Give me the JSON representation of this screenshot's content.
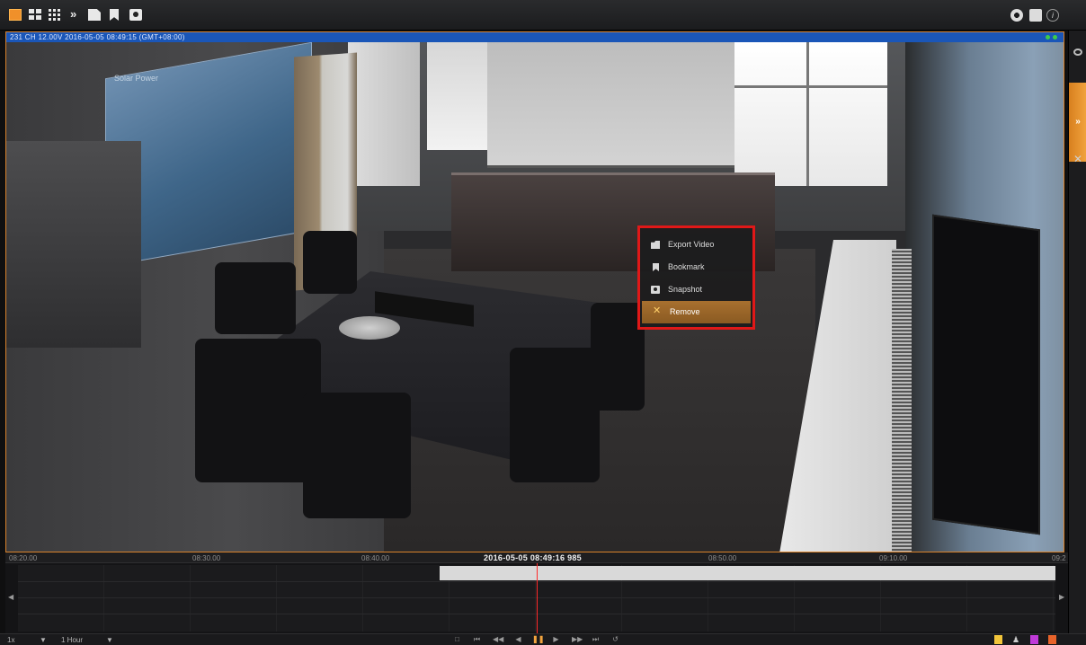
{
  "toolbar": {
    "more_label": "»",
    "info_label": "i",
    "icons": [
      "layout-single-icon",
      "layout-4-icon",
      "layout-9-icon",
      "more-icon",
      "save-icon",
      "bookmark-icon",
      "snapshot-icon",
      "settings-icon",
      "document-icon",
      "info-icon"
    ],
    "accent_color": "#f0902a"
  },
  "side_panel": {
    "expand_label": "»",
    "tools_label": "✕"
  },
  "video": {
    "header_text": "231 CH 12.00V 2016-05-05 08:49:15 (GMT+08:00)",
    "board_text": "Solar Power",
    "header_color": "#1a56b8"
  },
  "context_menu": {
    "items": [
      {
        "label": "Export Video",
        "icon": "export-video-icon"
      },
      {
        "label": "Bookmark",
        "icon": "bookmark-icon"
      },
      {
        "label": "Snapshot",
        "icon": "snapshot-icon"
      },
      {
        "label": "Remove",
        "icon": "remove-icon",
        "active": true
      }
    ],
    "remove_glyph": "✕",
    "highlight_color": "#e01818"
  },
  "timeline": {
    "tick_labels": [
      "08:20.00",
      "08:30.00",
      "08:40.00",
      "08:50.00",
      "09:10.00",
      "09:2"
    ],
    "current_time": "2016-05-05 08:49:16 985"
  },
  "bottom_bar": {
    "speed": "1x",
    "range": "1 Hour",
    "dropdown_glyph": "▼"
  }
}
